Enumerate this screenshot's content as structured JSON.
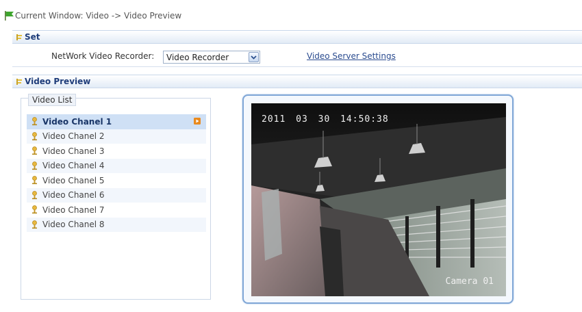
{
  "breadcrumb": {
    "text": "Current Window: Video -> Video Preview"
  },
  "set_section": {
    "title": "Set",
    "recorder_label": "NetWork Video Recorder:",
    "recorder_value": "Video Recorder",
    "server_link": "Video Server Settings"
  },
  "preview_section": {
    "title": "Video Preview",
    "list_title": "Video List",
    "channels": [
      {
        "label": "Video Chanel 1",
        "selected": true
      },
      {
        "label": "Video Chanel 2",
        "selected": false
      },
      {
        "label": "Video Chanel 3",
        "selected": false
      },
      {
        "label": "Video Chanel 4",
        "selected": false
      },
      {
        "label": "Video Chanel 5",
        "selected": false
      },
      {
        "label": "Video Chanel 6",
        "selected": false
      },
      {
        "label": "Video Chanel 7",
        "selected": false
      },
      {
        "label": "Video Chanel 8",
        "selected": false
      }
    ],
    "osd_timestamp": "2011 03 30 14:50:38",
    "osd_camera": "Camera 01"
  },
  "icons": {
    "breadcrumb": "flag-icon",
    "section": "section-marker-icon",
    "channel": "camera-icon",
    "play": "play-icon",
    "dropdown": "chevron-down-icon"
  },
  "colors": {
    "accent": "#1f3d7a",
    "link": "#2a4b8f",
    "selected_row": "#cfe0f5",
    "frame_border": "#7fa6d6"
  }
}
